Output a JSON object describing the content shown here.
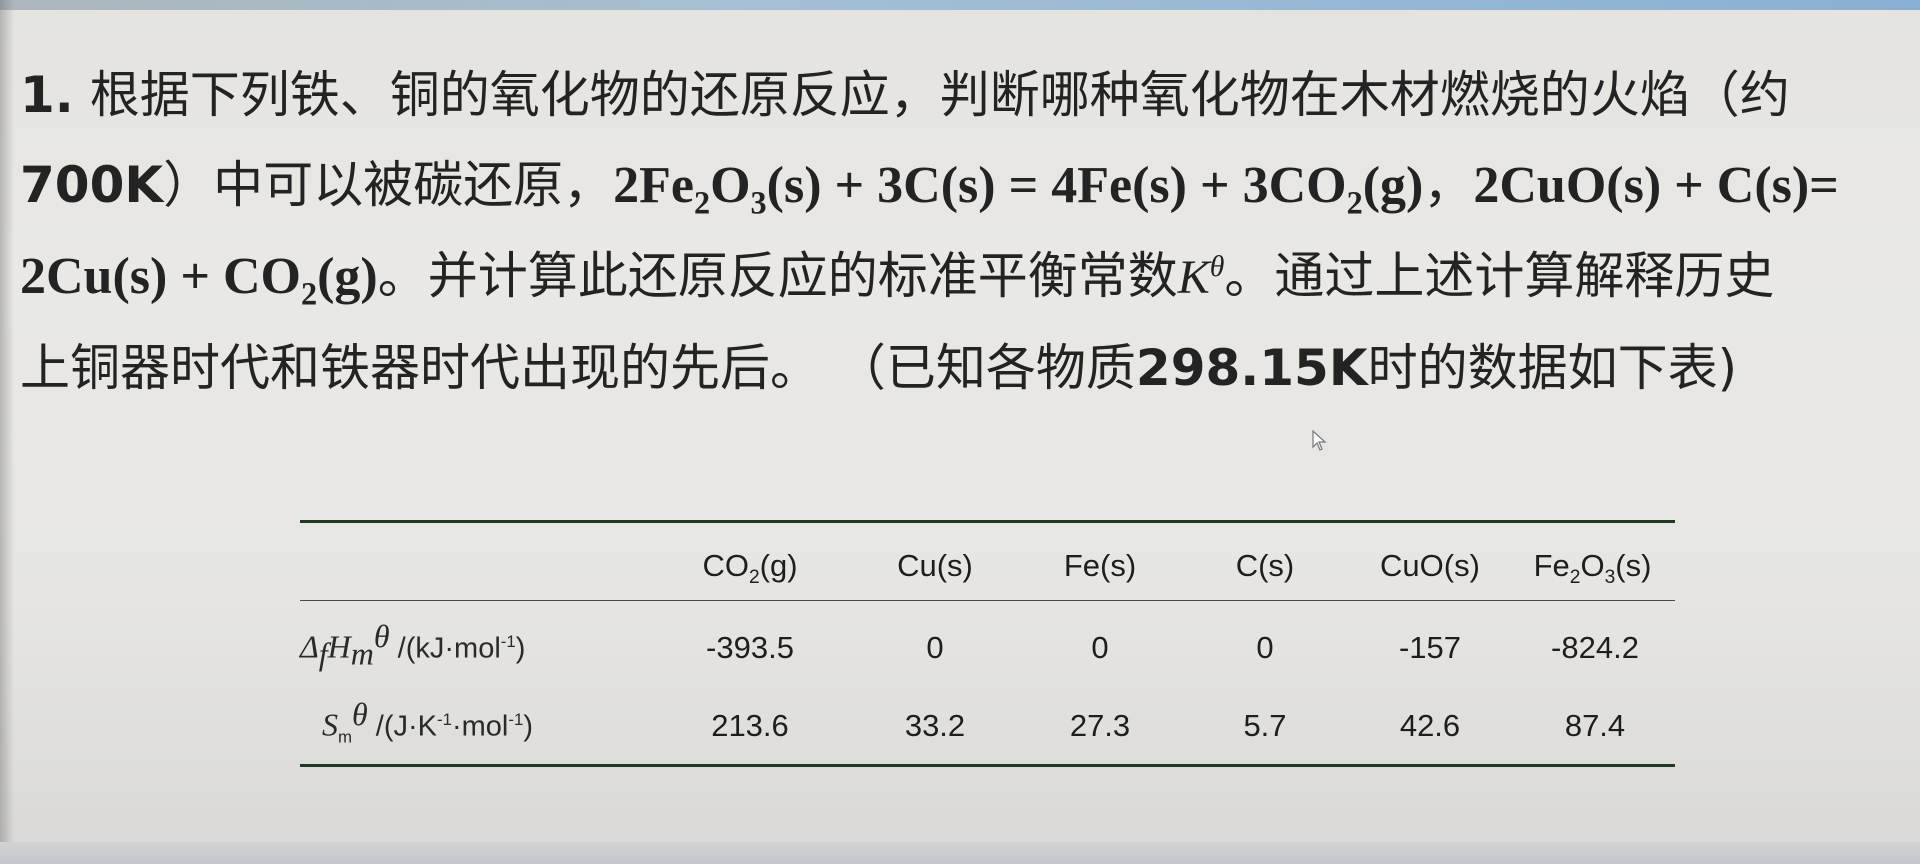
{
  "question": {
    "line1": {
      "number": "1.",
      "text": " 根据下列铁、铜的氧化物的还原反应，判断哪种氧化物在木材燃烧的火焰（约"
    },
    "line2": {
      "temp": "700K",
      "text_a": "）中可以被碳还原，",
      "eq1_a": "2Fe",
      "eq1_sub1": "2",
      "eq1_b": "O",
      "eq1_sub2": "3",
      "eq1_c": "(s) + 3C(s) = 4Fe(s) + 3CO",
      "eq1_sub3": "2",
      "eq1_d": "(g)",
      "sep": "，",
      "eq2_a": "2CuO(s) + C(s)="
    },
    "line3": {
      "eq2_b": "2Cu(s) + CO",
      "eq2_sub": "2",
      "eq2_c": "(g)",
      "text_a": "。并计算此还原反应的标准平衡常数",
      "k": "K",
      "k_sup": "θ",
      "text_b": "。通过上述计算解释历史"
    },
    "line4": {
      "text_a": "上铜器时代和铁器时代出现的先后。 （已知各物质",
      "temp": "298.15K",
      "text_b": "时的数据如下表)"
    }
  },
  "table": {
    "headers": [
      {
        "main": "CO",
        "sub": "2",
        "tail": "(g)"
      },
      {
        "main": "Cu(s)",
        "sub": "",
        "tail": ""
      },
      {
        "main": "Fe(s)",
        "sub": "",
        "tail": ""
      },
      {
        "main": "C(s)",
        "sub": "",
        "tail": ""
      },
      {
        "main": "CuO(s)",
        "sub": "",
        "tail": ""
      },
      {
        "main": "Fe",
        "sub": "2",
        "tail": "O",
        "sub2": "3",
        "tail2": "(s)"
      }
    ],
    "row1": {
      "label_delta": "Δ",
      "label_f": "f",
      "label_H": "H",
      "label_m": "m",
      "label_theta": "θ",
      "label_unit": " /(kJ·mol",
      "label_unit_sup": "-1",
      "label_unit_end": ")",
      "values": [
        "-393.5",
        "0",
        "0",
        "0",
        "-157",
        "-824.2"
      ]
    },
    "row2": {
      "label_S": "S",
      "label_m": "m",
      "label_theta": "θ",
      "label_unit_a": " /(J·K",
      "label_unit_sup1": "-1",
      "label_unit_b": "·mol",
      "label_unit_sup2": "-1",
      "label_unit_end": ")",
      "values": [
        "213.6",
        "33.2",
        "27.3",
        "5.7",
        "42.6",
        "87.4"
      ]
    }
  },
  "colors": {
    "rule": "#1f3a1f",
    "text": "#232323",
    "background": "#e8e7e4"
  },
  "icons": {
    "cursor": "mouse-pointer-icon"
  }
}
